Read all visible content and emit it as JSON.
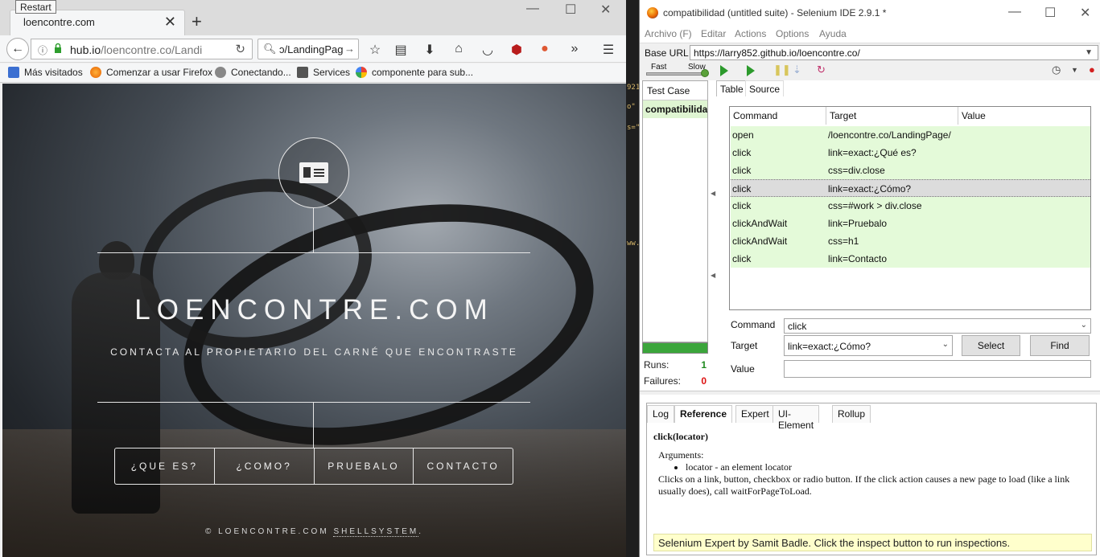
{
  "firefox": {
    "tooltip": "Restart",
    "tab_title": "loencontre.com",
    "url_host": "hub.io",
    "url_path": "/loencontre.co/Landi",
    "search_value": "ɔ/LandingPag",
    "bookmarks": [
      "Más visitados",
      "Comenzar a usar Firefox",
      "Conectando...",
      "Services",
      "componente para sub..."
    ]
  },
  "site": {
    "title": "LOENCONTRE.COM",
    "subtitle": "CONTACTA AL PROPIETARIO DEL CARNÉ QUE ENCONTRASTE",
    "nav": [
      "¿QUE ES?",
      "¿COMO?",
      "PRUEBALO",
      "CONTACTO"
    ],
    "footer_prefix": "© LOENCONTRE.COM ",
    "footer_link": "SHELLSYSTEM",
    "footer_suffix": "."
  },
  "editor_snippets": [
    "921",
    "o\"",
    "s=\"",
    "ww."
  ],
  "selenium": {
    "window_title": "compatibilidad (untitled suite) - Selenium IDE 2.9.1 *",
    "menu": [
      "Archivo (F)",
      "Editar",
      "Actions",
      "Options",
      "Ayuda"
    ],
    "base_url_label": "Base URL",
    "base_url": "https://larry852.github.io/loencontre.co/",
    "speed_fast": "Fast",
    "speed_slow": "Slow",
    "testcase_header": "Test Case",
    "testcase_name": "compatibilidad",
    "runs_label": "Runs:",
    "runs": "1",
    "failures_label": "Failures:",
    "failures": "0",
    "tabs": [
      "Table",
      "Source"
    ],
    "columns": [
      "Command",
      "Target",
      "Value"
    ],
    "commands": [
      {
        "command": "open",
        "target": "/loencontre.co/LandingPage/",
        "value": ""
      },
      {
        "command": "click",
        "target": "link=exact:¿Qué es?",
        "value": ""
      },
      {
        "command": "click",
        "target": "css=div.close",
        "value": ""
      },
      {
        "command": "click",
        "target": "link=exact:¿Cómo?",
        "value": ""
      },
      {
        "command": "click",
        "target": "css=#work > div.close",
        "value": ""
      },
      {
        "command": "clickAndWait",
        "target": "link=Pruebalo",
        "value": ""
      },
      {
        "command": "clickAndWait",
        "target": "css=h1",
        "value": ""
      },
      {
        "command": "click",
        "target": "link=Contacto",
        "value": ""
      }
    ],
    "selected_row": 3,
    "command_label": "Command",
    "command_value": "click",
    "target_label": "Target",
    "target_value": "link=exact:¿Cómo?",
    "value_label": "Value",
    "value_value": "",
    "select_button": "Select",
    "find_button": "Find",
    "ref_tabs": [
      "Log",
      "Reference",
      "Expert",
      "UI-Element",
      "Rollup"
    ],
    "ref_active": "Reference",
    "ref_heading": "click(locator)",
    "ref_args_label": "Arguments:",
    "ref_arg": "locator - an element locator",
    "ref_text": "Clicks on a link, button, checkbox or radio button. If the click action causes a new page to load (like a link usually does), call waitForPageToLoad.",
    "expert_msg": "Selenium Expert by Samit Badle. Click the inspect button to run inspections."
  }
}
